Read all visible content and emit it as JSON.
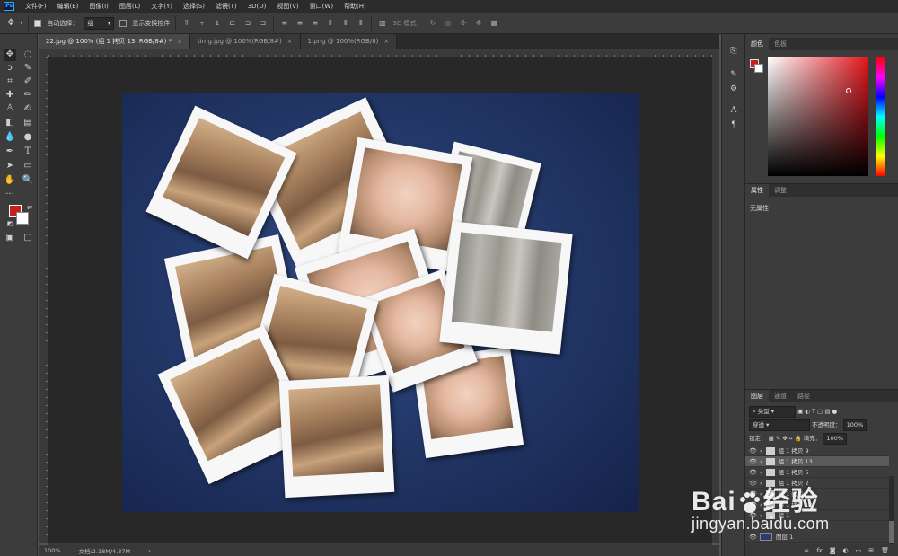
{
  "app": {
    "logo_text": "Ps"
  },
  "menu": [
    "文件(F)",
    "编辑(E)",
    "图像(I)",
    "图层(L)",
    "文字(Y)",
    "选择(S)",
    "滤镜(T)",
    "3D(D)",
    "视图(V)",
    "窗口(W)",
    "帮助(H)"
  ],
  "options_bar": {
    "auto_select_label": "自动选择：",
    "auto_select_value": "组",
    "show_transform_label": "显示变换控件",
    "mode_3d_label": "3D 模式："
  },
  "tabs": [
    {
      "label": "22.jpg @ 100% (组 1 拷贝 13, RGB/8#) *",
      "active": true
    },
    {
      "label": "timg.jpg @ 100%(RGB/8#)",
      "active": false
    },
    {
      "label": "1.png @ 100%(RGB/8)",
      "active": false
    }
  ],
  "status_bar": {
    "zoom": "100%",
    "doc_info": "文档:2.18M/4.37M"
  },
  "color_panel": {
    "tabs": [
      "颜色",
      "色板"
    ],
    "foreground": "#c3201f",
    "background": "#ffffff"
  },
  "properties_panel": {
    "tabs": [
      "属性",
      "调整"
    ],
    "empty_text": "无属性"
  },
  "layers_panel": {
    "tabs": [
      "图层",
      "通道",
      "路径"
    ],
    "filter_kind": "类型",
    "blend_mode": "穿透",
    "opacity_label": "不透明度：",
    "opacity_value": "100%",
    "lock_label": "锁定：",
    "fill_label": "填充：",
    "fill_value": "100%",
    "layers": [
      {
        "name": "组 1 拷贝 9",
        "type": "group",
        "selected": false
      },
      {
        "name": "组 1 拷贝 13",
        "type": "group",
        "selected": true
      },
      {
        "name": "组 1 拷贝 5",
        "type": "group",
        "selected": false
      },
      {
        "name": "组 1 拷贝 2",
        "type": "group",
        "selected": false
      },
      {
        "name": "组 1 拷贝",
        "type": "group",
        "selected": false
      },
      {
        "name": "组 1 拷贝 12",
        "type": "group",
        "selected": false
      },
      {
        "name": "组 1",
        "type": "group",
        "selected": false
      },
      {
        "name": "图层 1",
        "type": "image",
        "selected": false
      }
    ],
    "footer_icons": [
      "link-icon",
      "fx-icon",
      "mask-icon",
      "adjustment-icon",
      "folder-icon",
      "new-layer-icon",
      "trash-icon"
    ]
  },
  "watermark": {
    "brand": "Bai",
    "brand_suffix": "经验",
    "url": "jingyan.baidu.com"
  }
}
